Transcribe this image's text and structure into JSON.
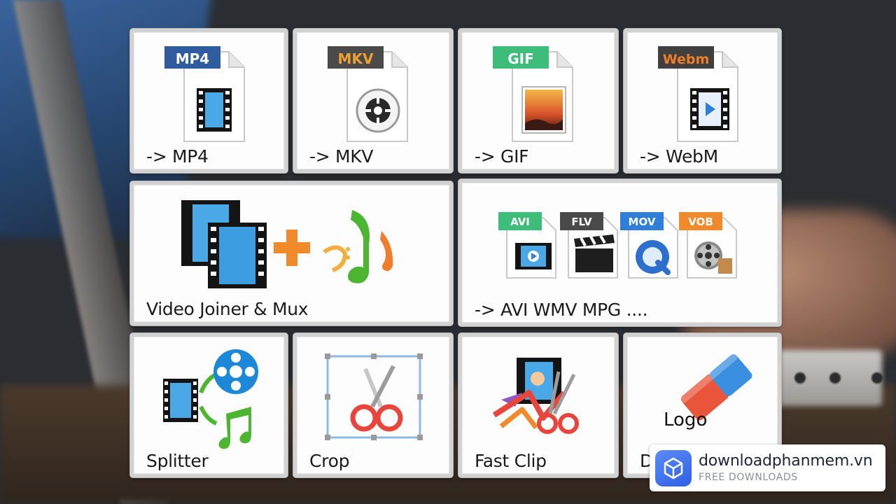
{
  "tiles": [
    {
      "label": "-> MP4",
      "badge": "MP4"
    },
    {
      "label": "-> MKV",
      "badge": "MKV"
    },
    {
      "label": "-> GIF",
      "badge": "GIF"
    },
    {
      "label": "-> WebM",
      "badge": "Webm"
    },
    {
      "label": "Video Joiner & Mux"
    },
    {
      "label": "-> AVI WMV MPG ....",
      "badges": [
        "AVI",
        "FLV",
        "MOV",
        "VOB"
      ]
    },
    {
      "label": "Splitter"
    },
    {
      "label": "Crop"
    },
    {
      "label": "Fast Clip"
    },
    {
      "label": "D",
      "logo_text": "Logo"
    }
  ],
  "watermark": {
    "site": "downloadphanmem.vn",
    "tagline": "FREE DOWNLOADS"
  },
  "colors": {
    "mp4_badge": "#2f5c9e",
    "mkv_badge": "#4a4a4a",
    "mkv_text": "#f0a030",
    "gif_badge": "#3ebd7a",
    "webm_badge": "#3f3f3f",
    "webm_text": "#f07d2a",
    "watermark_logo": "#3a6bf0"
  }
}
